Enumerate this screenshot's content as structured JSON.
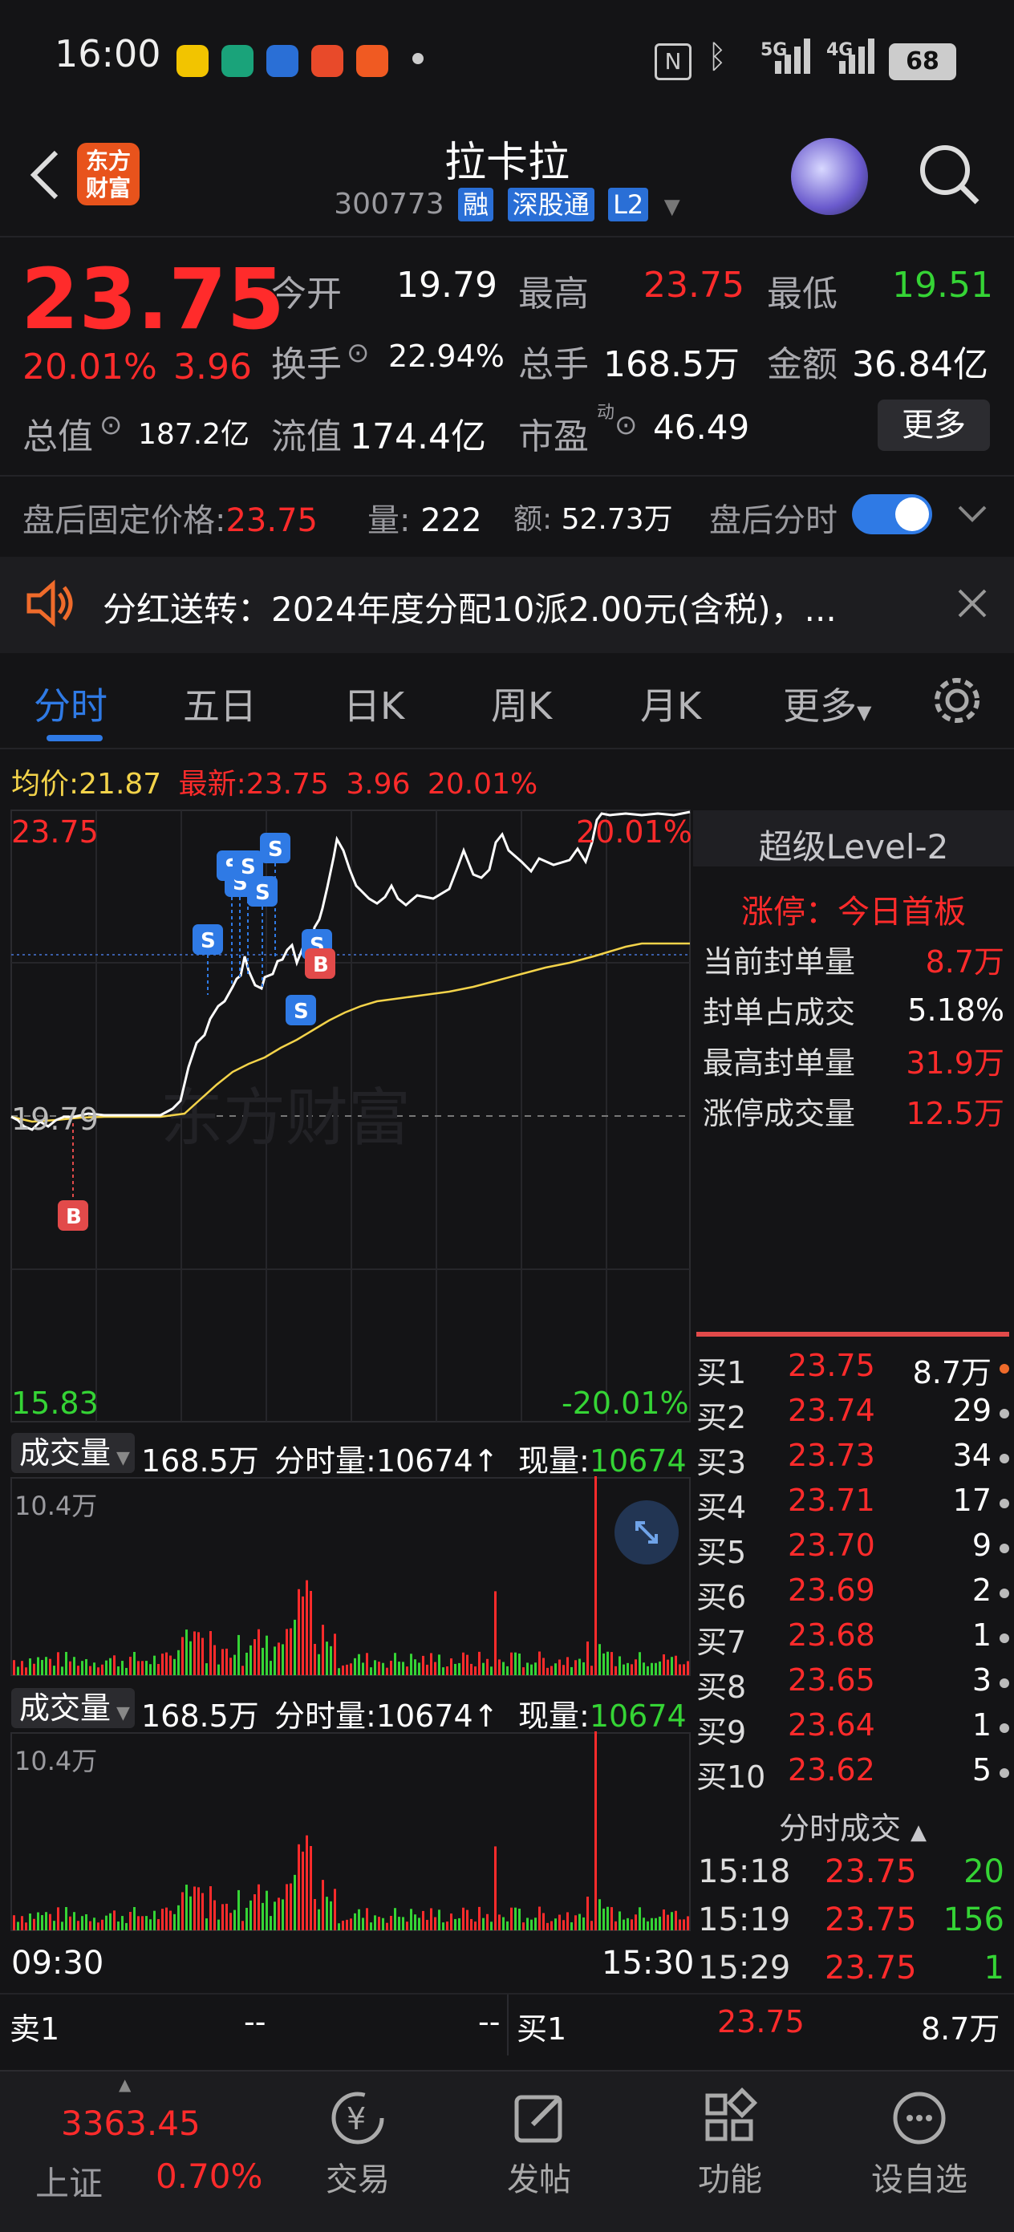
{
  "status_bar": {
    "time": "16:00",
    "battery": "68",
    "signal_5g": "5G",
    "signal_4g": "4G"
  },
  "header": {
    "title": "拉卡拉",
    "code": "300773",
    "tags": [
      "融",
      "深股通",
      "L2"
    ],
    "logo_text": "东方财富"
  },
  "quote": {
    "price": "23.75",
    "change_pct": "20.01%",
    "change": "3.96",
    "open_label": "今开",
    "open": "19.79",
    "high_label": "最高",
    "high": "23.75",
    "low_label": "最低",
    "low": "19.51",
    "turnover_label": "换手",
    "turnover": "22.94%",
    "volume_label": "总手",
    "volume": "168.5万",
    "amount_label": "金额",
    "amount": "36.84亿",
    "mktcap_label": "总值",
    "mktcap": "187.2亿",
    "float_label": "流值",
    "float_cap": "174.4亿",
    "pe_label": "市盈",
    "pe_sup": "动",
    "pe": "46.49",
    "more_button": "更多"
  },
  "after_hours": {
    "price_label": "盘后固定价格:",
    "price": "23.75",
    "vol_label": "量:",
    "vol": "222",
    "amt_label": "额:",
    "amt": "52.73万",
    "toggle_label": "盘后分时",
    "toggle_on": true
  },
  "notice": {
    "text": "分红送转：2024年度分配10派2.00元(含税)，..."
  },
  "tabs": [
    "分时",
    "五日",
    "日K",
    "周K",
    "月K",
    "更多"
  ],
  "active_tab": "分时",
  "chart_info": {
    "avg_label": "均价:",
    "avg": "21.87",
    "latest_label": "最新:",
    "latest": "23.75",
    "latest_chg": "3.96",
    "latest_pct": "20.01%",
    "top_price": "23.75",
    "top_pct": "20.01%",
    "bottom_price": "15.83",
    "bottom_pct": "-20.01%",
    "prev_close": "19.79",
    "watermark": "东方财富",
    "time_start": "09:30",
    "time_end": "15:30"
  },
  "volume_panels": [
    {
      "label": "成交量",
      "total": "168.5万",
      "period_label": "分时量:",
      "period": "10674↑",
      "now_label": "现量:",
      "now": "10674",
      "max": "10.4万"
    },
    {
      "label": "成交量",
      "total": "168.5万",
      "period_label": "分时量:",
      "period": "10674↑",
      "now_label": "现量:",
      "now": "10674",
      "max": "10.4万"
    }
  ],
  "level2": {
    "title": "超级Level-2",
    "limit_title": "涨停：今日首板",
    "stats": [
      {
        "label": "当前封单量",
        "value": "8.7万",
        "color": "red"
      },
      {
        "label": "封单占成交",
        "value": "5.18%",
        "color": "white"
      },
      {
        "label": "最高封单量",
        "value": "31.9万",
        "color": "red"
      },
      {
        "label": "涨停成交量",
        "value": "12.5万",
        "color": "red"
      }
    ]
  },
  "order_book": [
    {
      "label": "买1",
      "price": "23.75",
      "qty": "8.7万"
    },
    {
      "label": "买2",
      "price": "23.74",
      "qty": "29"
    },
    {
      "label": "买3",
      "price": "23.73",
      "qty": "34"
    },
    {
      "label": "买4",
      "price": "23.71",
      "qty": "17"
    },
    {
      "label": "买5",
      "price": "23.70",
      "qty": "9"
    },
    {
      "label": "买6",
      "price": "23.69",
      "qty": "2"
    },
    {
      "label": "买7",
      "price": "23.68",
      "qty": "1"
    },
    {
      "label": "买8",
      "price": "23.65",
      "qty": "3"
    },
    {
      "label": "买9",
      "price": "23.64",
      "qty": "1"
    },
    {
      "label": "买10",
      "price": "23.62",
      "qty": "5"
    }
  ],
  "ticks_title": "分时成交",
  "ticks": [
    {
      "time": "15:18",
      "price": "23.75",
      "vol": "20"
    },
    {
      "time": "15:19",
      "price": "23.75",
      "vol": "156"
    },
    {
      "time": "15:29",
      "price": "23.75",
      "vol": "1"
    }
  ],
  "bottom_quote": {
    "sell_label": "卖1",
    "sell_price": "--",
    "sell_qty": "--",
    "buy_label": "买1",
    "buy_price": "23.75",
    "buy_qty": "8.7万"
  },
  "bottom_nav": {
    "index_value": "3363.45",
    "index_name": "上证",
    "index_pct": "0.70%",
    "items": [
      "交易",
      "发帖",
      "功能",
      "设自选"
    ]
  },
  "colors": {
    "up": "#ff2b2b",
    "down": "#35d435",
    "accent": "#2f7ae5",
    "bg": "#141416"
  }
}
